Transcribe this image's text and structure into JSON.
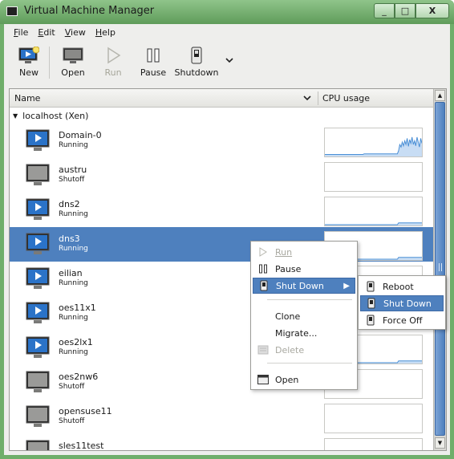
{
  "window": {
    "title": "Virtual Machine Manager",
    "buttons": {
      "minimize": "_",
      "maximize": "□",
      "close": "X"
    }
  },
  "menubar": [
    {
      "mnemonic": "F",
      "rest": "ile"
    },
    {
      "mnemonic": "E",
      "rest": "dit"
    },
    {
      "mnemonic": "V",
      "rest": "iew"
    },
    {
      "mnemonic": "H",
      "rest": "elp"
    }
  ],
  "toolbar": {
    "new": {
      "label": "New",
      "icon": "new-vm-icon"
    },
    "open": {
      "label": "Open",
      "icon": "monitor-icon"
    },
    "run": {
      "label": "Run",
      "icon": "play-icon",
      "enabled": false
    },
    "pause": {
      "label": "Pause",
      "icon": "pause-icon"
    },
    "shutdown": {
      "label": "Shutdown",
      "icon": "power-icon"
    },
    "more": {
      "icon": "chevron-down-icon"
    }
  },
  "list": {
    "columns": {
      "name": "Name",
      "cpu": "CPU usage"
    },
    "group": "localhost (Xen)",
    "rows": [
      {
        "name": "Domain-0",
        "state": "Running",
        "running": true,
        "cpu": [
          2,
          2,
          2,
          2,
          2,
          2,
          2,
          2,
          2,
          2,
          2,
          2,
          2,
          2,
          2,
          2,
          2,
          2,
          2,
          2,
          2,
          2,
          2,
          2,
          2,
          2,
          2,
          2,
          2,
          2,
          2,
          2,
          3,
          3,
          3,
          3,
          3,
          3,
          3,
          3,
          3,
          3,
          3,
          3,
          3,
          3,
          3,
          3,
          3,
          3,
          3,
          3,
          3,
          3,
          3,
          3,
          3,
          3,
          3,
          3,
          8,
          18,
          14,
          22,
          16,
          24,
          18,
          28,
          15,
          26,
          20,
          30,
          18,
          24,
          16,
          30,
          22,
          14,
          28,
          20
        ]
      },
      {
        "name": "austru",
        "state": "Shutoff",
        "running": false,
        "cpu": []
      },
      {
        "name": "dns2",
        "state": "Running",
        "running": true,
        "cpu": [
          0,
          0,
          0,
          0,
          0,
          0,
          0,
          0,
          0,
          0,
          0,
          0,
          0,
          0,
          0,
          0,
          0,
          0,
          0,
          0,
          0,
          0,
          0,
          0,
          0,
          0,
          0,
          0,
          0,
          0,
          0,
          0,
          0,
          0,
          0,
          0,
          0,
          0,
          0,
          0,
          0,
          0,
          0,
          0,
          0,
          0,
          0,
          0,
          0,
          0,
          0,
          0,
          0,
          0,
          0,
          0,
          0,
          0,
          0,
          0,
          3,
          3,
          3,
          3,
          3,
          3,
          3,
          3,
          3,
          3,
          3,
          3,
          3,
          3,
          3,
          3,
          3,
          3,
          3,
          3
        ]
      },
      {
        "name": "dns3",
        "state": "Running",
        "running": true,
        "selected": true,
        "cpu": [
          0,
          0,
          0,
          0,
          0,
          0,
          0,
          0,
          0,
          0,
          0,
          0,
          0,
          0,
          0,
          0,
          0,
          0,
          0,
          0,
          0,
          0,
          0,
          0,
          0,
          0,
          0,
          0,
          0,
          0,
          0,
          0,
          0,
          0,
          0,
          0,
          0,
          0,
          0,
          0,
          0,
          0,
          0,
          0,
          0,
          0,
          0,
          0,
          0,
          0,
          0,
          0,
          0,
          0,
          0,
          0,
          0,
          0,
          0,
          0,
          3,
          3,
          3,
          3,
          3,
          3,
          3,
          3,
          3,
          3,
          3,
          3,
          3,
          3,
          3,
          3,
          3,
          3,
          3,
          3
        ]
      },
      {
        "name": "eilian",
        "state": "Running",
        "running": true,
        "cpu": []
      },
      {
        "name": "oes11x1",
        "state": "Running",
        "running": true,
        "cpu": []
      },
      {
        "name": "oes2lx1",
        "state": "Running",
        "running": true,
        "cpu": [
          0,
          0,
          0,
          0,
          0,
          0,
          0,
          0,
          0,
          0,
          0,
          0,
          0,
          0,
          0,
          0,
          0,
          0,
          0,
          0,
          0,
          0,
          0,
          0,
          0,
          0,
          0,
          0,
          0,
          0,
          0,
          0,
          0,
          0,
          0,
          0,
          0,
          0,
          0,
          0,
          0,
          0,
          0,
          0,
          0,
          0,
          0,
          0,
          0,
          0,
          0,
          0,
          0,
          0,
          0,
          0,
          0,
          0,
          0,
          0,
          3,
          3,
          3,
          3,
          3,
          3,
          3,
          3,
          3,
          3,
          3,
          3,
          3,
          3,
          3,
          3,
          3,
          3,
          3,
          3
        ]
      },
      {
        "name": "oes2nw6",
        "state": "Shutoff",
        "running": false,
        "cpu": []
      },
      {
        "name": "opensuse11",
        "state": "Shutoff",
        "running": false,
        "cpu": []
      },
      {
        "name": "sles11test",
        "state": "",
        "running": false,
        "cpu": []
      }
    ]
  },
  "context_menu": {
    "run": "Run",
    "pause": "Pause",
    "shut_down": "Shut Down",
    "clone": "Clone",
    "migrate": "Migrate...",
    "delete": "Delete",
    "open": "Open"
  },
  "submenu": {
    "reboot": "Reboot",
    "shut_down": "Shut Down",
    "force_off": "Force Off"
  },
  "colors": {
    "accent": "#4e80be",
    "chart_line": "#4a8fd6",
    "chart_fill": "#c8ddf4",
    "titlebar": "#6fae6a"
  }
}
